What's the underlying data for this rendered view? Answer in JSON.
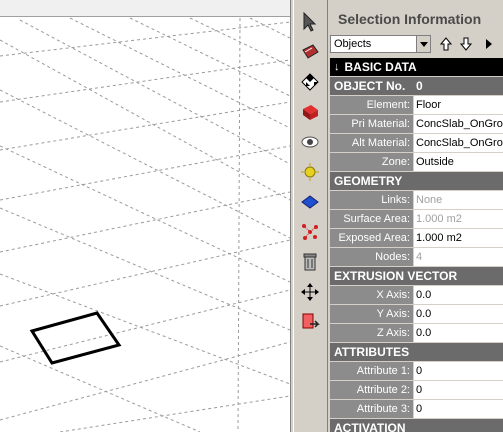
{
  "panel": {
    "title": "Selection Information",
    "filter_value": "Objects"
  },
  "sections": {
    "basic_data": "BASIC DATA",
    "object_no_label": "OBJECT No.",
    "object_no_value": "0",
    "geometry": "GEOMETRY",
    "extrusion": "EXTRUSION VECTOR",
    "attributes": "ATTRIBUTES",
    "activation": "ACTIVATION"
  },
  "basic": {
    "element_label": "Element:",
    "element_value": "Floor",
    "pri_label": "Pri Material:",
    "pri_value": "ConcSlab_OnGround",
    "alt_label": "Alt Material:",
    "alt_value": "ConcSlab_OnGround",
    "zone_label": "Zone:",
    "zone_value": "Outside"
  },
  "geometry": {
    "links_label": "Links:",
    "links_value": "None",
    "surface_label": "Surface Area:",
    "surface_value": "1.000 m2",
    "exposed_label": "Exposed Area:",
    "exposed_value": "1.000 m2",
    "nodes_label": "Nodes:",
    "nodes_value": "4"
  },
  "extrusion": {
    "x_label": "X Axis:",
    "x_value": "0.0",
    "y_label": "Y Axis:",
    "y_value": "0.0",
    "z_label": "Z Axis:",
    "z_value": "0.0"
  },
  "attributes": {
    "a1_label": "Attribute 1:",
    "a1_value": "0",
    "a2_label": "Attribute 2:",
    "a2_value": "0",
    "a3_label": "Attribute 3:",
    "a3_value": "0"
  },
  "colors": {
    "section_black": "#000000",
    "section_gray": "#6b6b6b",
    "label_gray": "#8c8c8c",
    "panel_bg": "#d4d0c8"
  },
  "icons": {
    "toolbar": [
      "pointer-icon",
      "select-tool-icon",
      "checker-icon",
      "red-block-icon",
      "eye-icon",
      "sun-icon",
      "blue-plane-icon",
      "nodes-icon",
      "trash-icon",
      "move-icon",
      "export-icon"
    ]
  }
}
